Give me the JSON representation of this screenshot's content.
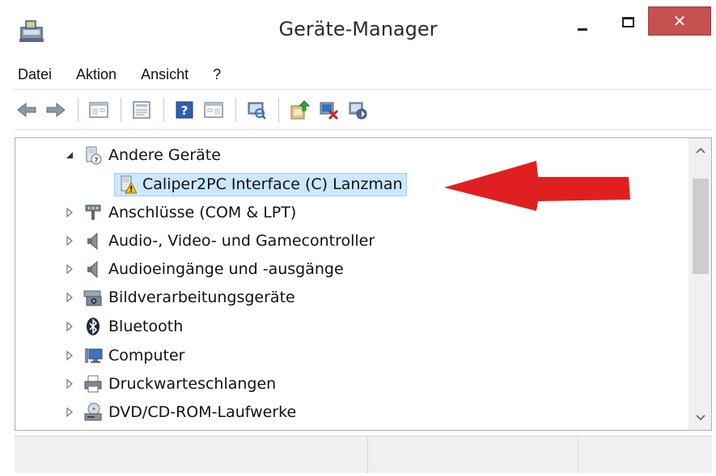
{
  "window": {
    "title": "Geräte-Manager",
    "icon": "device-manager-icon",
    "controls": {
      "minimize": "minimize-icon",
      "maximize": "maximize-icon",
      "close_label": "✕"
    },
    "close_color": "#c75050"
  },
  "menu": {
    "items": [
      "Datei",
      "Aktion",
      "Ansicht",
      "?"
    ]
  },
  "toolbar": {
    "buttons": [
      "back-arrow-icon",
      "forward-arrow-icon",
      "show-hide-tree-icon",
      "properties-icon",
      "help-icon",
      "view-icon",
      "scan-hardware-icon",
      "update-driver-icon",
      "uninstall-device-icon",
      "disable-device-icon"
    ]
  },
  "tree": {
    "nodes": [
      {
        "label": "Andere Geräte",
        "expanded": true,
        "icon": "unknown-device-icon",
        "level": 0
      },
      {
        "label": "Caliper2PC Interface (C) Lanzman",
        "icon": "warning-device-icon",
        "level": 1,
        "selected": true
      },
      {
        "label": "Anschlüsse (COM & LPT)",
        "expanded": false,
        "icon": "port-icon",
        "level": 0
      },
      {
        "label": "Audio-, Video- und Gamecontroller",
        "expanded": false,
        "icon": "speaker-icon",
        "level": 0
      },
      {
        "label": "Audioeingänge und -ausgänge",
        "expanded": false,
        "icon": "speaker-icon",
        "level": 0
      },
      {
        "label": "Bildverarbeitungsgeräte",
        "expanded": false,
        "icon": "camera-icon",
        "level": 0
      },
      {
        "label": "Bluetooth",
        "expanded": false,
        "icon": "bluetooth-icon",
        "level": 0
      },
      {
        "label": "Computer",
        "expanded": false,
        "icon": "computer-icon",
        "level": 0
      },
      {
        "label": "Druckwarteschlangen",
        "expanded": false,
        "icon": "printer-icon",
        "level": 0
      },
      {
        "label": "DVD/CD-ROM-Laufwerke",
        "expanded": false,
        "icon": "dvd-drive-icon",
        "level": 0
      }
    ]
  },
  "annotation": {
    "arrow_color": "#e02020"
  },
  "statusbar": {
    "cells": [
      "",
      "",
      ""
    ]
  }
}
